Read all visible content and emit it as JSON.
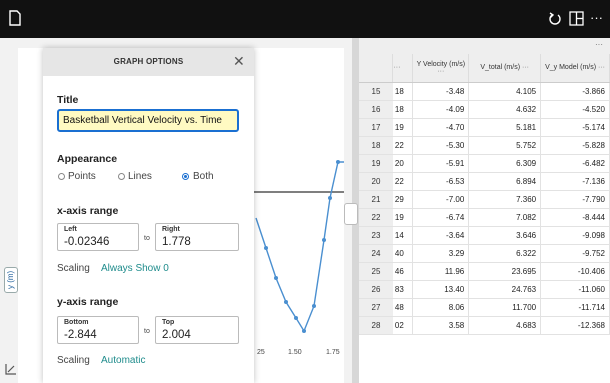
{
  "topbar": {
    "doc_icon": "document-icon",
    "undo_icon": "undo-icon",
    "layout_icon": "layout-icon",
    "more_icon": "more-icon"
  },
  "graph": {
    "y_axis_label": "y (m)",
    "x_ticks": [
      "25",
      "1.50",
      "1.75"
    ],
    "colors": {
      "line": "#4a8fd0",
      "horizontal": "#333333"
    }
  },
  "options": {
    "header": "GRAPH OPTIONS",
    "title_section": "Title",
    "title_value": "Basketball Vertical Velocity vs. Time",
    "appearance_section": "Appearance",
    "appearance_options": [
      "Points",
      "Lines",
      "Both"
    ],
    "appearance_selected": "Both",
    "x_range_section": "x-axis range",
    "x_left_label": "Left",
    "x_left_value": "-0.02346",
    "x_right_label": "Right",
    "x_right_value": "1.778",
    "to_label": "to",
    "x_scaling_label": "Scaling",
    "x_scaling_value": "Always Show 0",
    "y_range_section": "y-axis range",
    "y_bottom_label": "Bottom",
    "y_bottom_value": "-2.844",
    "y_top_label": "Top",
    "y_top_value": "2.004",
    "y_scaling_label": "Scaling",
    "y_scaling_value": "Automatic",
    "accent": "#1a6fd1",
    "highlight": "#fffac2"
  },
  "table": {
    "more": "···",
    "columns": [
      "",
      "Y Velocity (m/s)",
      "V_total (m/s)",
      "V_y Model (m/s)"
    ],
    "rows": [
      [
        "15",
        "18",
        "-3.48",
        "4.105",
        "-3.866"
      ],
      [
        "16",
        "18",
        "-4.09",
        "4.632",
        "-4.520"
      ],
      [
        "17",
        "19",
        "-4.70",
        "5.181",
        "-5.174"
      ],
      [
        "18",
        "22",
        "-5.30",
        "5.752",
        "-5.828"
      ],
      [
        "19",
        "20",
        "-5.91",
        "6.309",
        "-6.482"
      ],
      [
        "20",
        "22",
        "-6.53",
        "6.894",
        "-7.136"
      ],
      [
        "21",
        "29",
        "-7.00",
        "7.360",
        "-7.790"
      ],
      [
        "22",
        "19",
        "-6.74",
        "7.082",
        "-8.444"
      ],
      [
        "23",
        "14",
        "-3.64",
        "3.646",
        "-9.098"
      ],
      [
        "24",
        "40",
        "3.29",
        "6.322",
        "-9.752"
      ],
      [
        "25",
        "46",
        "11.96",
        "23.695",
        "-10.406"
      ],
      [
        "26",
        "83",
        "13.40",
        "24.763",
        "-11.060"
      ],
      [
        "27",
        "48",
        "8.06",
        "11.700",
        "-11.714"
      ],
      [
        "28",
        "02",
        "3.58",
        "4.683",
        "-12.368"
      ]
    ]
  }
}
